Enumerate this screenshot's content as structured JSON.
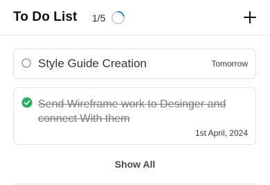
{
  "header": {
    "title": "To Do List",
    "progress_text": "1/5",
    "progress_fraction": 0.2,
    "add_icon": "plus-icon"
  },
  "tasks": [
    {
      "title": "Style Guide Creation",
      "due": "Tomorrow",
      "completed": false,
      "status_icon": "empty-circle-icon"
    },
    {
      "title": "Send Wireframe work to Desinger and connect With them",
      "due": "1st April, 2024",
      "completed": true,
      "status_icon": "check-circle-icon"
    }
  ],
  "footer": {
    "show_all_label": "Show All"
  },
  "colors": {
    "accent": "#1a7ae0",
    "complete": "#24b05c"
  }
}
